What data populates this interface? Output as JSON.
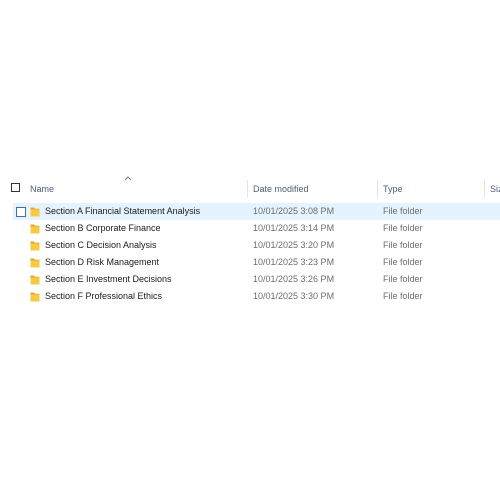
{
  "columns": {
    "name": "Name",
    "date_modified": "Date modified",
    "type": "Type",
    "size": "Siz"
  },
  "sort": {
    "column": "name",
    "icon": "sort-up-chevron-icon"
  },
  "rows": [
    {
      "name": "Section A Financial Statement Analysis",
      "date": "10/01/2025 3:08 PM",
      "type": "File folder",
      "selected": true
    },
    {
      "name": "Section B Corporate Finance",
      "date": "10/01/2025 3:14 PM",
      "type": "File folder"
    },
    {
      "name": "Section C Decision Analysis",
      "date": "10/01/2025 3:20 PM",
      "type": "File folder"
    },
    {
      "name": "Section D Risk Management",
      "date": "10/01/2025 3:23 PM",
      "type": "File folder"
    },
    {
      "name": "Section E Investment Decisions",
      "date": "10/01/2025 3:26 PM",
      "type": "File folder"
    },
    {
      "name": "Section F Professional Ethics",
      "date": "10/01/2025 3:30 PM",
      "type": "File folder"
    }
  ],
  "colors": {
    "selection": "#e5f3ff",
    "folder": "#f5c242",
    "header_text": "#4c607a",
    "secondary_text": "#6d6d6d"
  }
}
